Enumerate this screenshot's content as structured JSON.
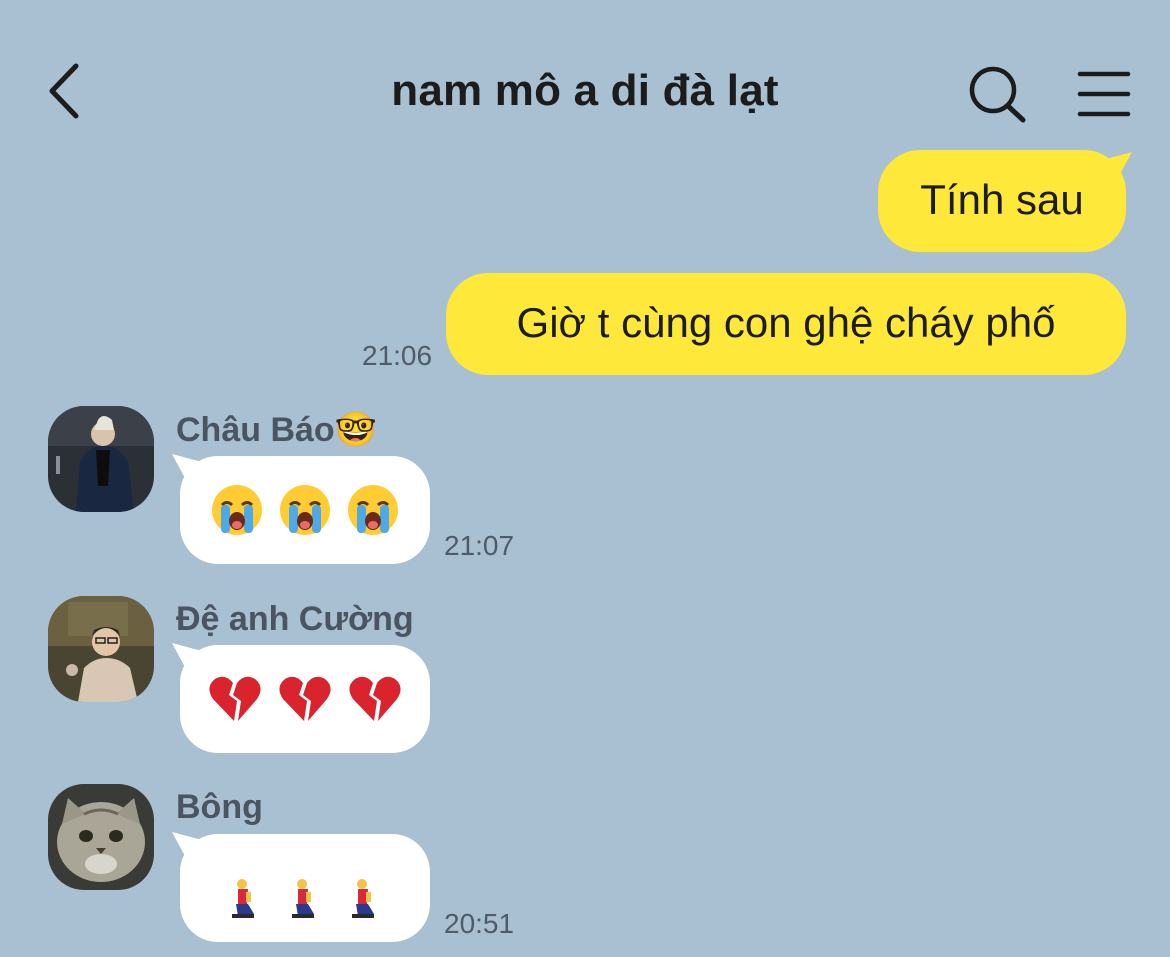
{
  "header": {
    "title": "nam mô a di đà lạt"
  },
  "messages_out": [
    {
      "text": "Tính sau",
      "time": ""
    },
    {
      "text": "Giờ t cùng con ghệ cháy phố",
      "time": "21:06"
    }
  ],
  "messages_in": [
    {
      "sender": "Châu Báo🤓",
      "emoji": [
        "loudly-crying-face",
        "loudly-crying-face",
        "loudly-crying-face"
      ],
      "time": "21:07"
    },
    {
      "sender": "Đệ anh Cường",
      "emoji": [
        "broken-heart",
        "broken-heart",
        "broken-heart"
      ],
      "time": ""
    },
    {
      "sender": "Bông",
      "emoji": [
        "person-kneeling",
        "person-kneeling",
        "person-kneeling"
      ],
      "time": "20:51"
    }
  ],
  "colors": {
    "background": "#a9bfd2",
    "outgoing_bubble": "#fee83a",
    "incoming_bubble": "#ffffff"
  }
}
